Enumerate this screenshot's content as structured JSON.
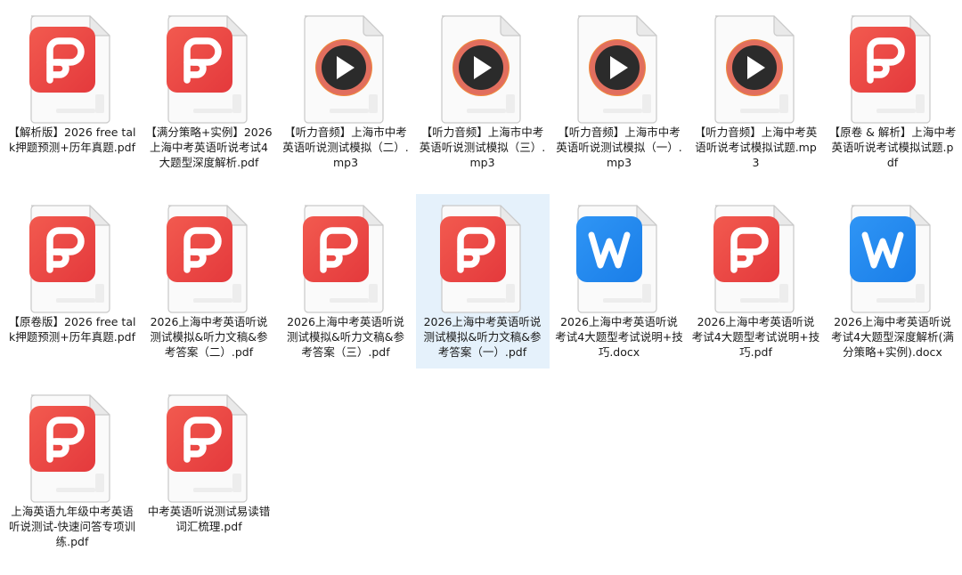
{
  "window": {
    "view": "large-icons"
  },
  "colors": {
    "pdf_red": "#e4393c",
    "pdf_red_light": "#f25a4f",
    "word_blue": "#1a7ee8",
    "media_ring": "#d6587a",
    "selection": "#e5f1fb"
  },
  "files": [
    {
      "name": "【解析版】2026 free talk押题预测+历年真题.pdf",
      "type": "pdf",
      "icon": "pdf-icon",
      "selected": false
    },
    {
      "name": "【满分策略+实例】2026上海中考英语听说考试4大题型深度解析.pdf",
      "type": "pdf",
      "icon": "pdf-icon",
      "selected": false
    },
    {
      "name": "【听力音频】上海市中考英语听说测试模拟（二）.mp3",
      "type": "mp3",
      "icon": "media-play-icon",
      "selected": false
    },
    {
      "name": "【听力音频】上海市中考英语听说测试模拟（三）.mp3",
      "type": "mp3",
      "icon": "media-play-icon",
      "selected": false
    },
    {
      "name": "【听力音频】上海市中考英语听说测试模拟（一）.mp3",
      "type": "mp3",
      "icon": "media-play-icon",
      "selected": false
    },
    {
      "name": "【听力音频】上海中考英语听说考试模拟试题.mp3",
      "type": "mp3",
      "icon": "media-play-icon",
      "selected": false
    },
    {
      "name": "【原卷 & 解析】上海中考英语听说考试模拟试题.pdf",
      "type": "pdf",
      "icon": "pdf-icon",
      "selected": false
    },
    {
      "name": "【原卷版】2026 free talk押题预测+历年真题.pdf",
      "type": "pdf",
      "icon": "pdf-icon",
      "selected": false
    },
    {
      "name": "2026上海中考英语听说测试模拟&听力文稿&参考答案（二）.pdf",
      "type": "pdf",
      "icon": "pdf-icon",
      "selected": false
    },
    {
      "name": "2026上海中考英语听说测试模拟&听力文稿&参考答案（三）.pdf",
      "type": "pdf",
      "icon": "pdf-icon",
      "selected": false
    },
    {
      "name": "2026上海中考英语听说测试模拟&听力文稿&参考答案（一）.pdf",
      "type": "pdf",
      "icon": "pdf-icon",
      "selected": true
    },
    {
      "name": "2026上海中考英语听说考试4大题型考试说明+技巧.docx",
      "type": "docx",
      "icon": "word-icon",
      "selected": false
    },
    {
      "name": "2026上海中考英语听说考试4大题型考试说明+技巧.pdf",
      "type": "pdf",
      "icon": "pdf-icon",
      "selected": false
    },
    {
      "name": "2026上海中考英语听说考试4大题型深度解析(满分策略+实例).docx",
      "type": "docx",
      "icon": "word-icon",
      "selected": false
    },
    {
      "name": "上海英语九年级中考英语听说测试-快速问答专项训练.pdf",
      "type": "pdf",
      "icon": "pdf-icon",
      "selected": false
    },
    {
      "name": "中考英语听说测试易读错词汇梳理.pdf",
      "type": "pdf",
      "icon": "pdf-icon",
      "selected": false
    }
  ]
}
